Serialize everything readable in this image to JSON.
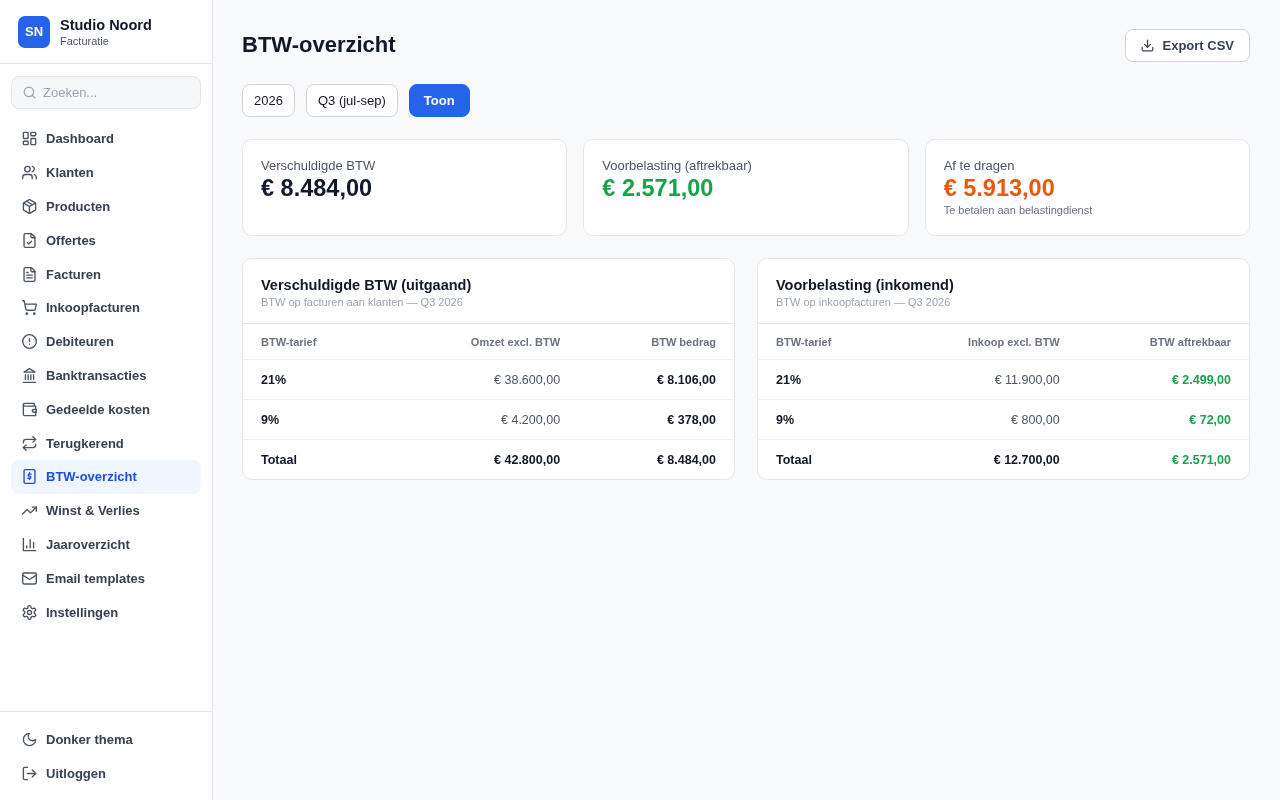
{
  "sidebar": {
    "brand": {
      "logo": "SN",
      "name": "Studio Noord",
      "subtitle": "Facturatie"
    },
    "search": {
      "placeholder": "Zoeken..."
    },
    "items": [
      {
        "label": "Dashboard",
        "selected": false
      },
      {
        "label": "Klanten",
        "selected": false
      },
      {
        "label": "Producten",
        "selected": false
      },
      {
        "label": "Offertes",
        "selected": false
      },
      {
        "label": "Facturen",
        "selected": false
      },
      {
        "label": "Inkoopfacturen",
        "selected": false
      },
      {
        "label": "Debiteuren",
        "selected": false
      },
      {
        "label": "Banktransacties",
        "selected": false
      },
      {
        "label": "Gedeelde kosten",
        "selected": false
      },
      {
        "label": "Terugkerend",
        "selected": false
      },
      {
        "label": "BTW-overzicht",
        "selected": true
      },
      {
        "label": "Winst & Verlies",
        "selected": false
      },
      {
        "label": "Jaaroverzicht",
        "selected": false
      },
      {
        "label": "Email templates",
        "selected": false
      },
      {
        "label": "Instellingen",
        "selected": false
      }
    ],
    "footer_items": [
      {
        "label": "Donker thema"
      },
      {
        "label": "Uitloggen"
      }
    ]
  },
  "header": {
    "title": "BTW-overzicht",
    "export_button": "Export CSV"
  },
  "filters": {
    "year": "2026",
    "period": "Q3 (jul-sep)",
    "apply_button": "Toon"
  },
  "stats": [
    {
      "label": "Verschuldigde BTW",
      "value": "€ 8.484,00",
      "color": "#111827"
    },
    {
      "label": "Voorbelasting (aftrekbaar)",
      "value": "€ 2.571,00",
      "color": "#16a34a"
    },
    {
      "label": "Af te dragen",
      "value": "€ 5.913,00",
      "color": "#ea580c",
      "note": "Te betalen aan belastingdienst"
    }
  ],
  "tables": [
    {
      "title": "Verschuldigde BTW (uitgaand)",
      "subtitle": "BTW op facturen aan klanten — Q3 2026",
      "columns": [
        {
          "label": "BTW-tarief"
        },
        {
          "label": "Omzet excl. BTW"
        },
        {
          "label": "BTW bedrag",
          "color": "#111827"
        }
      ],
      "rows": [
        {
          "kind": "rate",
          "cells": [
            "21%",
            "€ 38.600,00",
            "€ 8.106,00"
          ]
        },
        {
          "kind": "rate",
          "cells": [
            "9%",
            "€ 4.200,00",
            "€ 378,00"
          ]
        },
        {
          "kind": "total",
          "cells": [
            "Totaal",
            "€ 42.800,00",
            "€ 8.484,00"
          ]
        }
      ]
    },
    {
      "title": "Voorbelasting (inkomend)",
      "subtitle": "BTW op inkoopfacturen — Q3 2026",
      "columns": [
        {
          "label": "BTW-tarief"
        },
        {
          "label": "Inkoop excl. BTW"
        },
        {
          "label": "BTW aftrekbaar",
          "color": "#16a34a"
        }
      ],
      "rows": [
        {
          "kind": "rate",
          "cells": [
            "21%",
            "€ 11.900,00",
            "€ 2.499,00"
          ]
        },
        {
          "kind": "rate",
          "cells": [
            "9%",
            "€ 800,00",
            "€ 72,00"
          ]
        },
        {
          "kind": "total",
          "cells": [
            "Totaal",
            "€ 12.700,00",
            "€ 2.571,00"
          ]
        }
      ]
    }
  ]
}
